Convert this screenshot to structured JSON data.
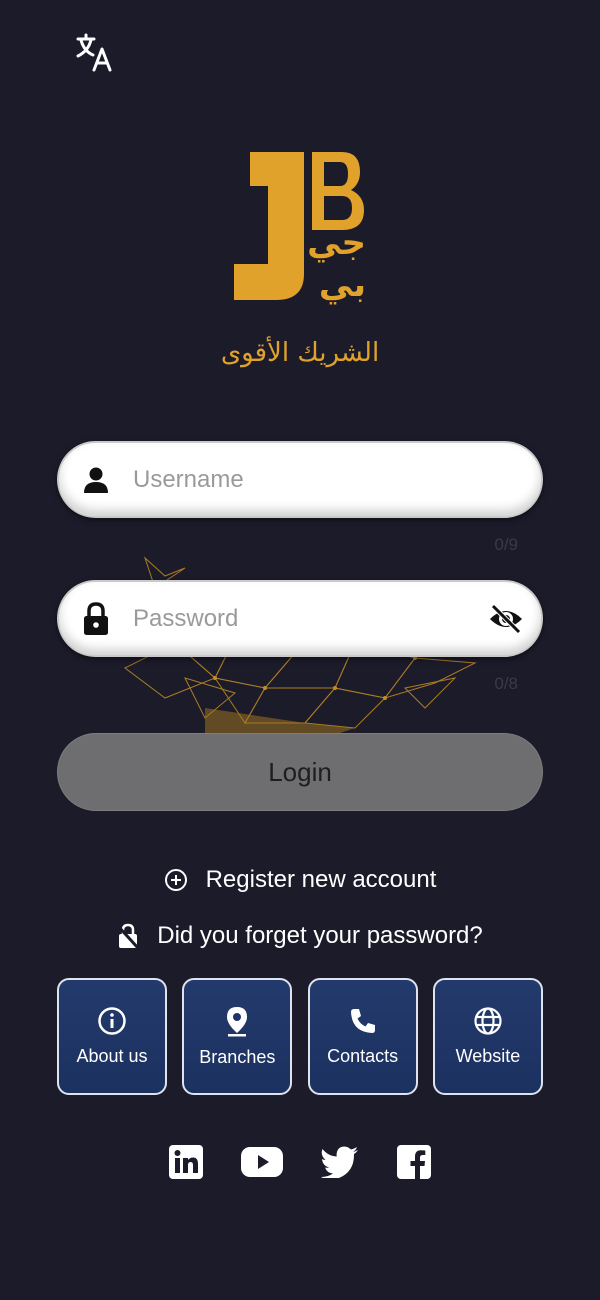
{
  "header": {
    "language_icon": "translate-icon"
  },
  "brand": {
    "logo_latin": "JB",
    "logo_arabic_line1": "جي",
    "logo_arabic_line2": "بي",
    "tagline": "الشريك الأقوى",
    "accent_color": "#e0a22a"
  },
  "form": {
    "username": {
      "placeholder": "Username",
      "value": "",
      "counter": "0/9",
      "icon": "person-icon"
    },
    "password": {
      "placeholder": "Password",
      "value": "",
      "counter": "0/8",
      "icon": "lock-icon",
      "toggle_icon": "eye-off-icon"
    },
    "login_label": "Login"
  },
  "links": {
    "register": {
      "label": "Register new account",
      "icon": "plus-circle-icon"
    },
    "forgot": {
      "label": "Did you forget your password?",
      "icon": "lock-open-icon"
    }
  },
  "tiles": [
    {
      "label": "About us",
      "icon": "info-icon"
    },
    {
      "label": "Branches",
      "icon": "location-pin-icon"
    },
    {
      "label": "Contacts",
      "icon": "phone-icon"
    },
    {
      "label": "Website",
      "icon": "globe-icon"
    }
  ],
  "social": [
    {
      "icon": "linkedin-icon"
    },
    {
      "icon": "youtube-icon"
    },
    {
      "icon": "twitter-icon"
    },
    {
      "icon": "facebook-icon"
    }
  ],
  "colors": {
    "background": "#1c1b2a",
    "tile_bg": "#1f3566",
    "login_bg": "#6e6e70"
  }
}
